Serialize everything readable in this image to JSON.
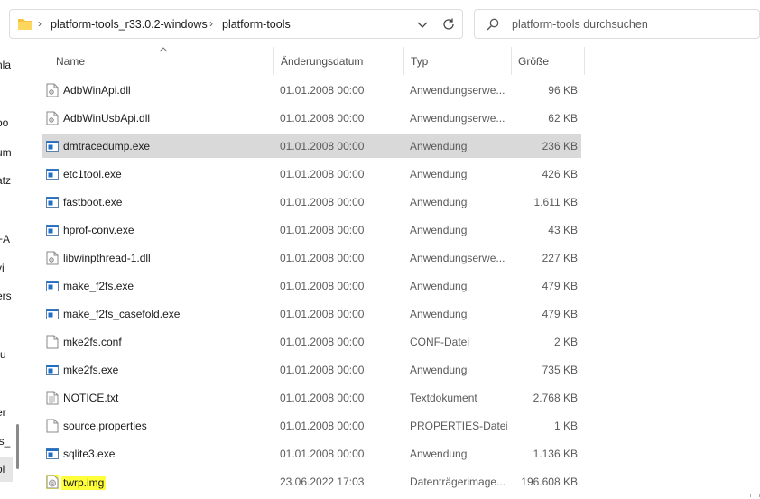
{
  "address": {
    "crumbs": [
      "platform-tools_r33.0.2-windows",
      "platform-tools"
    ],
    "folder_icon": "folder-icon",
    "dropdown_icon": "chevron-down-icon",
    "refresh_icon": "refresh-icon"
  },
  "search": {
    "placeholder": "platform-tools durchsuchen",
    "icon": "search-icon"
  },
  "nav": {
    "items": [
      "nla",
      "oo",
      "um",
      "atz",
      "+A",
      "vi",
      "ers",
      "ru",
      "er",
      "ls_",
      "ol"
    ]
  },
  "columns": {
    "name": "Name",
    "date": "Änderungsdatum",
    "type": "Typ",
    "size": "Größe"
  },
  "files": [
    {
      "name": "AdbWinApi.dll",
      "date": "01.01.2008 00:00",
      "type": "Anwendungserwe...",
      "size": "96 KB",
      "icon": "dll"
    },
    {
      "name": "AdbWinUsbApi.dll",
      "date": "01.01.2008 00:00",
      "type": "Anwendungserwe...",
      "size": "62 KB",
      "icon": "dll"
    },
    {
      "name": "dmtracedump.exe",
      "date": "01.01.2008 00:00",
      "type": "Anwendung",
      "size": "236 KB",
      "icon": "exe"
    },
    {
      "name": "etc1tool.exe",
      "date": "01.01.2008 00:00",
      "type": "Anwendung",
      "size": "426 KB",
      "icon": "exe"
    },
    {
      "name": "fastboot.exe",
      "date": "01.01.2008 00:00",
      "type": "Anwendung",
      "size": "1.611 KB",
      "icon": "exe"
    },
    {
      "name": "hprof-conv.exe",
      "date": "01.01.2008 00:00",
      "type": "Anwendung",
      "size": "43 KB",
      "icon": "exe"
    },
    {
      "name": "libwinpthread-1.dll",
      "date": "01.01.2008 00:00",
      "type": "Anwendungserwe...",
      "size": "227 KB",
      "icon": "dll"
    },
    {
      "name": "make_f2fs.exe",
      "date": "01.01.2008 00:00",
      "type": "Anwendung",
      "size": "479 KB",
      "icon": "exe"
    },
    {
      "name": "make_f2fs_casefold.exe",
      "date": "01.01.2008 00:00",
      "type": "Anwendung",
      "size": "479 KB",
      "icon": "exe"
    },
    {
      "name": "mke2fs.conf",
      "date": "01.01.2008 00:00",
      "type": "CONF-Datei",
      "size": "2 KB",
      "icon": "doc"
    },
    {
      "name": "mke2fs.exe",
      "date": "01.01.2008 00:00",
      "type": "Anwendung",
      "size": "735 KB",
      "icon": "exe"
    },
    {
      "name": "NOTICE.txt",
      "date": "01.01.2008 00:00",
      "type": "Textdokument",
      "size": "2.768 KB",
      "icon": "txt"
    },
    {
      "name": "source.properties",
      "date": "01.01.2008 00:00",
      "type": "PROPERTIES-Datei",
      "size": "1 KB",
      "icon": "doc"
    },
    {
      "name": "sqlite3.exe",
      "date": "01.01.2008 00:00",
      "type": "Anwendung",
      "size": "1.136 KB",
      "icon": "exe"
    },
    {
      "name": "twrp.img",
      "date": "23.06.2022 17:03",
      "type": "Datenträgerimage...",
      "size": "196.608 KB",
      "icon": "img"
    }
  ],
  "selected_index": 2,
  "highlighted_index": 14,
  "colors": {
    "selection": "#d9d9d9",
    "highlight": "#ffff3a",
    "exe_blue": "#1f6fc5"
  }
}
